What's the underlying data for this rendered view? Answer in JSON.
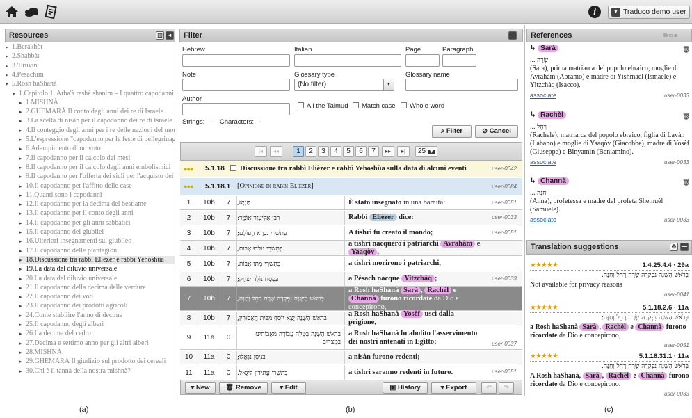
{
  "user_menu": "Traduco demo user",
  "resources": {
    "title": "Resources",
    "items": [
      {
        "text": "1.Berakhòt",
        "tri": "▸",
        "indent": 0,
        "style": ""
      },
      {
        "text": "2.Shabbàt",
        "tri": "▸",
        "indent": 0,
        "style": ""
      },
      {
        "text": "3.'Eruvìn",
        "tri": "▸",
        "indent": 0,
        "style": ""
      },
      {
        "text": "4.Pesachìm",
        "tri": "▸",
        "indent": 0,
        "style": ""
      },
      {
        "text": "5.Rosh haShanà",
        "tri": "▾",
        "indent": 0,
        "style": ""
      },
      {
        "text": "1.Capitolo 1. Arba'à rashè shanìm – I quattro capodanni",
        "tri": "▾",
        "indent": 1,
        "style": ""
      },
      {
        "text": "1.MISHNÀ",
        "tri": "▸",
        "indent": 2,
        "style": ""
      },
      {
        "text": "2.GHEMARÀ Il conto degli anni dei re di Israele",
        "tri": "▸",
        "indent": 2,
        "style": ""
      },
      {
        "text": "3.La scelta di nisàn per il capodanno dei re di Israele",
        "tri": "▸",
        "indent": 2,
        "style": ""
      },
      {
        "text": "4.Il conteggio degli anni per i re delle nazioni del mondo",
        "tri": "▸",
        "indent": 2,
        "style": ""
      },
      {
        "text": "5.L'espressione \"capodanno per le feste di pellegrinaggio\"",
        "tri": "▸",
        "indent": 2,
        "style": ""
      },
      {
        "text": "6.Adempimento di un voto",
        "tri": "▸",
        "indent": 2,
        "style": ""
      },
      {
        "text": "7.Il capodanno per il calcolo dei mesi",
        "tri": "▸",
        "indent": 2,
        "style": ""
      },
      {
        "text": "8.Il capodanno per il calcolo degli anni embolismici",
        "tri": "▸",
        "indent": 2,
        "style": ""
      },
      {
        "text": "9.Il capodanno per l'offerta dei sicli per l'acquisto dei sacrifici",
        "tri": "▸",
        "indent": 2,
        "style": ""
      },
      {
        "text": "10.Il capodanno per l'affitto delle case",
        "tri": "▸",
        "indent": 2,
        "style": ""
      },
      {
        "text": "11.Quanti sono i capodanni",
        "tri": "▸",
        "indent": 2,
        "style": ""
      },
      {
        "text": "12.Il capodanno per la decima del bestiame",
        "tri": "▸",
        "indent": 2,
        "style": ""
      },
      {
        "text": "13.Il capodanno per il conto degli anni",
        "tri": "▸",
        "indent": 2,
        "style": ""
      },
      {
        "text": "14.Il capodanno per gli anni sabbatici",
        "tri": "▸",
        "indent": 2,
        "style": ""
      },
      {
        "text": "15.Il capodanno dei giubilei",
        "tri": "▸",
        "indent": 2,
        "style": ""
      },
      {
        "text": "16.Ulteriori insegnamenti sul giubileo",
        "tri": "▸",
        "indent": 2,
        "style": ""
      },
      {
        "text": "17.Il capodanno delle piantagioni",
        "tri": "▸",
        "indent": 2,
        "style": ""
      },
      {
        "text": "18.Discussione tra rabbì Elièzer e rabbì Yehoshùa",
        "tri": "▸",
        "indent": 2,
        "style": "sel"
      },
      {
        "text": "19.La data del diluvio universale",
        "tri": "▸",
        "indent": 2,
        "style": "dark"
      },
      {
        "text": "20.La data del diluvio universale",
        "tri": "▸",
        "indent": 2,
        "style": ""
      },
      {
        "text": "21.Il capodanno della decima delle verdure",
        "tri": "▸",
        "indent": 2,
        "style": ""
      },
      {
        "text": "22.Il capodanno dei voti",
        "tri": "▸",
        "indent": 2,
        "style": ""
      },
      {
        "text": "23.Il capodanno dei prodotti agricoli",
        "tri": "▸",
        "indent": 2,
        "style": ""
      },
      {
        "text": "24.Come stabilire l'anno di decima",
        "tri": "▸",
        "indent": 2,
        "style": ""
      },
      {
        "text": "25.Il capodanno degli alberi",
        "tri": "▸",
        "indent": 2,
        "style": ""
      },
      {
        "text": "26.La decima del cedro",
        "tri": "▸",
        "indent": 2,
        "style": ""
      },
      {
        "text": "27.Decima e settimo anno per gli altri alberi",
        "tri": "▸",
        "indent": 2,
        "style": ""
      },
      {
        "text": "28.MISHNÀ",
        "tri": "▸",
        "indent": 2,
        "style": ""
      },
      {
        "text": "29.GHEMARÀ Il giudizio sul prodotto dei cereali",
        "tri": "▸",
        "indent": 2,
        "style": ""
      },
      {
        "text": "30.Chi è il tannà della nostra mishnà?",
        "tri": "▸",
        "indent": 2,
        "style": ""
      }
    ]
  },
  "filter": {
    "title": "Filter",
    "labels": {
      "hebrew": "Hebrew",
      "italian": "Italian",
      "page": "Page",
      "paragraph": "Paragraph",
      "note": "Note",
      "glossary_type": "Glossary type",
      "glossary_name": "Glossary name",
      "author": "Author",
      "strings": "Strings:",
      "strings_val": "-",
      "characters": "Characters:",
      "characters_val": "-"
    },
    "glossary_type_value": "(No filter)",
    "checkboxes": [
      "All the Talmud",
      "Match case",
      "Whole word"
    ],
    "filter_btn": "Filter",
    "cancel_btn": "Cancel"
  },
  "pager": {
    "pages": [
      "1",
      "2",
      "3",
      "4",
      "5",
      "6",
      "7"
    ],
    "current": "1",
    "page_size": "25"
  },
  "table": {
    "section": {
      "id": "5.1.18",
      "title": "Discussione tra rabbì Elièzer e rabbì Yehoshùa sulla data di alcuni eventi",
      "user": "user-0042"
    },
    "subsection": {
      "id": "5.1.18.1",
      "title": "[Opinione di rabbì Elièzer]",
      "user": "user-0084"
    },
    "rows": [
      {
        "n": "1",
        "page": "10b",
        "par": "7",
        "heb": "תַּנְיָא,",
        "it": "<b>È stato insegnato</b> in una baraità:",
        "user": "user-0051"
      },
      {
        "n": "2",
        "page": "10b",
        "par": "7",
        "heb": "רַבִּי אֱלִיעֶזֶר אוֹמֵר:",
        "it": "<b>Rabbì <span class=\"tag blue\">Elièzer</span> dice:</b>",
        "user": "user-0033"
      },
      {
        "n": "3",
        "page": "10b",
        "par": "7",
        "heb": "בְּתִשְׁרֵי נִבְרָא הָעוֹלָם;",
        "it": "<b>A tishrì fu creato il mondo;</b>",
        "user": "user-0051"
      },
      {
        "n": "4",
        "page": "10b",
        "par": "7",
        "heb": "בְּתִשְׁרֵי נוֹלְדוּ אָבוֹת,",
        "it": "<b>a tishrì nacquero i patriarchi <span class=\"tag\">Avrahàm</span> e <span class=\"tag\">Yaaqòv</span>,</b>",
        "user": ""
      },
      {
        "n": "5",
        "page": "10b",
        "par": "7",
        "heb": "בְּתִשְׁרֵי מֵתוּ אָבוֹת,",
        "it": "<b>a tishrì morirono i patriarchi,</b>",
        "user": ""
      },
      {
        "n": "6",
        "page": "10b",
        "par": "7",
        "heb": "בְּפֶסַח נוֹלַד יִצְחָק;",
        "it": "<b>a Pèsach nacque <span class=\"tag\">Yitzchàq</span>;</b>",
        "user": "user-0033"
      },
      {
        "n": "7",
        "page": "10b",
        "par": "7",
        "heb": "בְּרֹאשׁ הַשָּׁנָה נִפְקְדָה שָׂרָה רָחֵל וְחַנָּה,",
        "it": "<b>a Rosh haShanà <span class=\"tag\">Sarà</span>, <span class=\"tag\">Rachèl</span> e <span class=\"tag\">Channà</span> furono ricordate</b> da Dio e concepirono,",
        "user": ""
      },
      {
        "n": "8",
        "page": "10b",
        "par": "7",
        "heb": "בְּרֹאשׁ הַשָּׁנָה יָצָא יוֹסֵף מִבֵּית הָאֲסוּרִין,",
        "it": "<b>a Rosh haShanà <span class=\"tag\">Yosèf</span> uscì dalla prigione,</b>",
        "user": ""
      },
      {
        "n": "9",
        "page": "11a",
        "par": "0",
        "heb": "בְּרֹאשׁ הַשָּׁנָה בָּטְלָה עֲבוֹדָה מֵאֲבוֹתֵינוּ בְּמִצְרַיִם;",
        "it": "<b>a Rosh haShanà fu abolito l'asservimento dei nostri antenati in Egitto;</b>",
        "user": "user-0037"
      },
      {
        "n": "10",
        "page": "11a",
        "par": "0",
        "heb": "בְּנִיסָן נִגְאֲלוּ;",
        "it": "<b>a nisàn furono redenti;</b>",
        "user": ""
      },
      {
        "n": "11",
        "page": "11a",
        "par": "0",
        "heb": "בְּתִשְׁרֵי עֲתִידִין לִיגָּאֵל.",
        "it": "<b>a tishrì saranno redenti in futuro.</b>",
        "user": "user-0051"
      }
    ]
  },
  "toolbar": {
    "new": "New",
    "remove": "Remove",
    "edit": "Edit",
    "history": "History",
    "export": "Export"
  },
  "references": {
    "title": "References",
    "items": [
      {
        "name": "Sarà",
        "ellipsis": "...",
        "heb": "שָׂרָה",
        "desc": "(Sara), prima matriarca del popolo ebraico, moglie di Avrahàm (Abramo) e madre di Yishmaèl (Ismaele) e Yitzchàq (Isacco).",
        "assoc": "associate",
        "user": "user-0033"
      },
      {
        "name": "Rachèl",
        "ellipsis": "...",
        "heb": "רָחֵל",
        "desc": "(Rachele), matriarca del popolo ebraico, figlia di Lavàn (Labano) e moglie di Yaaqòv (Giacobbe), madre di Yosèf (Giuseppe) e Binyamìn (Beniamino).",
        "assoc": "associate",
        "user": "user-0033"
      },
      {
        "name": "Channà",
        "ellipsis": "...",
        "heb": "חַנָּה",
        "desc": "(Anna), profetessa e madre del profeta Shemuèl (Samuele).",
        "assoc": "associate",
        "user": "user-0033"
      }
    ]
  },
  "suggestions": {
    "title": "Translation suggestions",
    "items": [
      {
        "stars": "★★★★★",
        "ref": "1.4.25.4.4 · 29a",
        "heb": "בְּרֹאשׁ הַשָּׁנָה נִפְקְדָה שָׂרָה רָחֵל וְחַנָּה.",
        "text": "Not available for privacy reasons",
        "user": "user-0041"
      },
      {
        "stars": "★★★★★",
        "ref": "5.1.18.2.6 · 11a",
        "heb": "בְּרֹאשׁ הַשָּׁנָה נִפְקְדָה שָׂרָה רָחֵל וְחַנָּה;",
        "text": "<b>a Rosh haShanà <span class=\"tag\">Sarà</span>, <span class=\"tag\">Rachèl</span> e <span class=\"tag\">Channà</span> furono ricordate</b> da Dio e concepirono,",
        "user": "user-0051"
      },
      {
        "stars": "★★★★★",
        "ref": "5.1.18.31.1 · 11a",
        "heb": "בְּרֹאשׁ הַשָּׁנָה נִפְקְדָה שָׂרָה רָחֵל וְחַנָּה.",
        "text": "<b>A Rosh haShanà, <span class=\"tag\">Sarà</span>, <span class=\"tag\">Rachèl</span> e <span class=\"tag\">Channà</span> furono ricordate</b> da Dio e concepirono.",
        "user": "user-0033"
      }
    ]
  },
  "captions": [
    "(a)",
    "(b)",
    "(c)"
  ]
}
